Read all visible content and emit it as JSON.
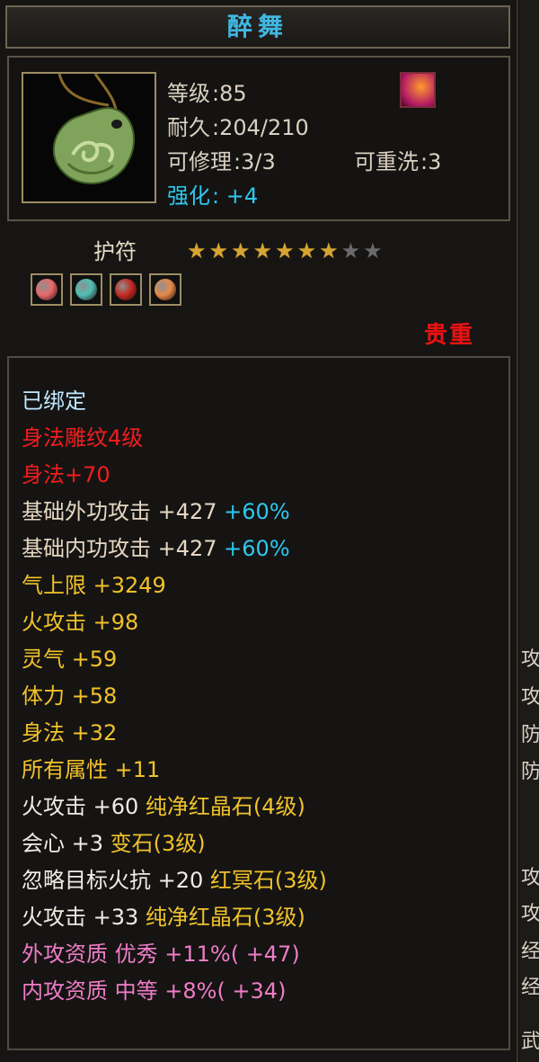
{
  "title": "醉舞",
  "item": {
    "icon": "jade-pendant-icon",
    "level_label": "等级",
    "level_value": ":85",
    "durability_label": "耐久",
    "durability_value": ":204/210",
    "repair_label": "可修理",
    "repair_value": ":3/3",
    "rewash_label": "可重洗",
    "rewash_value": ":3",
    "enhance_label": "强化",
    "enhance_value": ": +4",
    "badge_icon": "flame-badge-icon"
  },
  "type": "护符",
  "stars": {
    "filled": 7,
    "total": 9
  },
  "gems": [
    {
      "icon": "gem-pink-icon",
      "color": "#e86a6a"
    },
    {
      "icon": "gem-teal-icon",
      "color": "#4fbfb4"
    },
    {
      "icon": "gem-red-icon",
      "color": "#c42a22"
    },
    {
      "icon": "gem-orange-icon",
      "color": "#e58a4a"
    }
  ],
  "rarity": "贵重",
  "attributes": [
    {
      "text": "已绑定",
      "color": "light-blue"
    },
    {
      "text": "身法雕纹4级",
      "color": "red"
    },
    {
      "text": "身法+70",
      "color": "red"
    },
    {
      "text": "基础外功攻击  +427",
      "extra": " +60%",
      "color": "beige"
    },
    {
      "text": "基础内功攻击  +427",
      "extra": " +60%",
      "color": "beige"
    },
    {
      "text": "气上限  +3249",
      "color": "yellow"
    },
    {
      "text": "火攻击  +98",
      "color": "yellow"
    },
    {
      "text": "灵气  +59",
      "color": "yellow"
    },
    {
      "text": "体力  +58",
      "color": "yellow"
    },
    {
      "text": "身法  +32",
      "color": "yellow"
    },
    {
      "text": "所有属性  +11",
      "color": "yellow"
    },
    {
      "text": "火攻击  +60  ",
      "extra": "纯净红晶石(4级)",
      "color": "white"
    },
    {
      "text": "会心  +3  ",
      "extra": "变石(3级)",
      "color": "white"
    },
    {
      "text": "忽略目标火抗  +20  ",
      "extra": "红冥石(3级)",
      "color": "white"
    },
    {
      "text": "火攻击  +33  ",
      "extra": "纯净红晶石(3级)",
      "color": "white"
    },
    {
      "text": "外攻资质    优秀  +11%( +47)",
      "color": "pink"
    },
    {
      "text": "内攻资质    中等  +8%( +34)",
      "color": "pink"
    }
  ],
  "side_chars": [
    "攻",
    "攻",
    "防",
    "防",
    "攻",
    "攻",
    "经",
    "经",
    "武"
  ]
}
